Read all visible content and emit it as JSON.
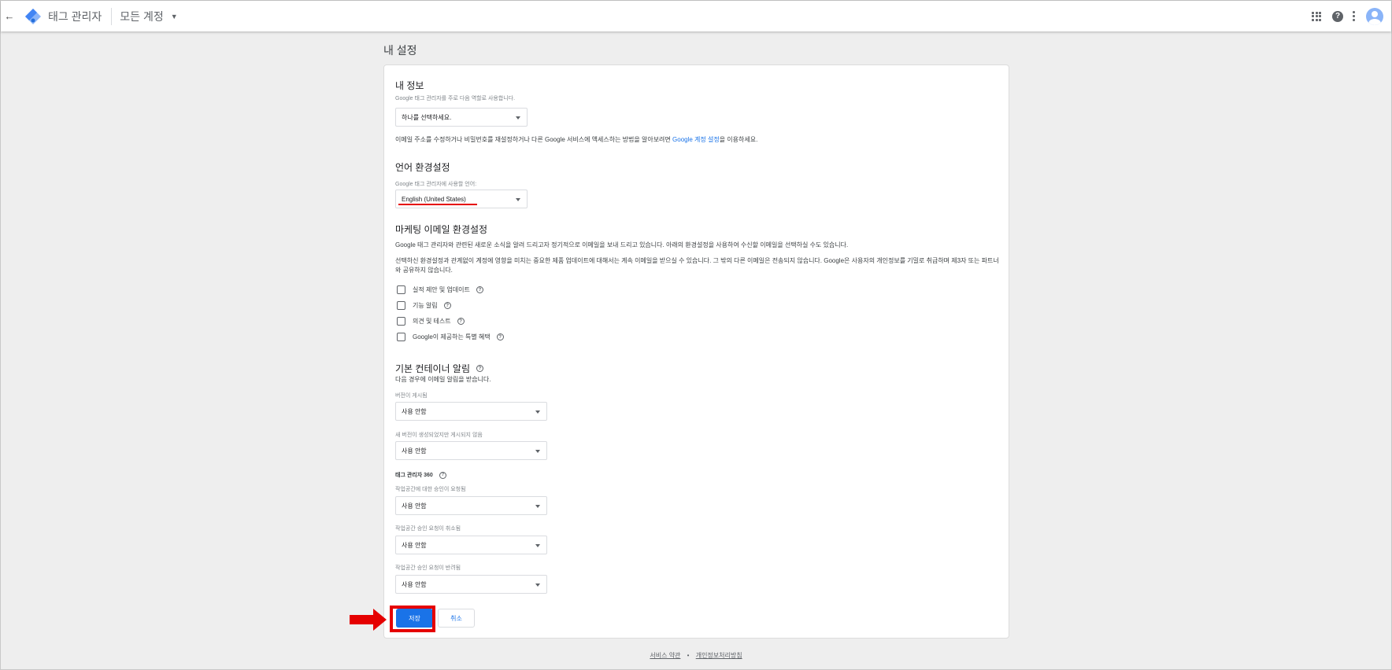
{
  "header": {
    "app_name": "태그 관리자",
    "account_label": "모든 계정"
  },
  "page_title": "내 설정",
  "my_info": {
    "heading": "내 정보",
    "role_label": "Google 태그 관리자를 주로 다음 역할로 사용합니다.",
    "role_value": "하나를 선택하세요.",
    "desc_before": "이메일 주소를 수정하거나 비밀번호를 재설정하거나 다른 Google 서비스에 액세스하는 방법을 알아보려면 ",
    "desc_link": "Google 계정 설정",
    "desc_after": "을 이용하세요."
  },
  "language": {
    "heading": "언어 환경설정",
    "label": "Google 태그 관리자에 사용할 언어:",
    "value": "English (United States)"
  },
  "marketing": {
    "heading": "마케팅 이메일 환경설정",
    "desc1": "Google 태그 관리자와 관련된 새로운 소식을 알려 드리고자 정기적으로 이메일을 보내 드리고 있습니다. 아래의 환경설정을 사용하여 수신할 이메일을 선택하실 수도 있습니다.",
    "desc2": "선택하신 환경설정과 관계없이 계정에 영향을 미치는 중요한 제품 업데이트에 대해서는 계속 이메일을 받으실 수 있습니다. 그 밖의 다른 이메일은 전송되지 않습니다. Google은 사용자의 개인정보를 기밀로 취급하며 제3자 또는 파트너와 공유하지 않습니다.",
    "options": [
      {
        "label": "실적 제안 및 업데이트",
        "checked": false
      },
      {
        "label": "기능 알림",
        "checked": false
      },
      {
        "label": "의견 및 테스트",
        "checked": false
      },
      {
        "label": "Google이 제공하는 특별 혜택",
        "checked": false
      }
    ]
  },
  "notifications": {
    "heading": "기본 컨테이너 알림",
    "desc": "다음 경우에 이메일 알림을 받습니다.",
    "published_label": "버전이 게시됨",
    "published_value": "사용 안함",
    "created_label": "새 버전이 생성되었지만 게시되지 않음",
    "created_value": "사용 안함",
    "tm360_heading": "태그 관리자 360",
    "approval_requested_label": "작업공간에 대한 승인이 요청됨",
    "approval_requested_value": "사용 안함",
    "approval_cancelled_label": "작업공간 승인 요청이 취소됨",
    "approval_cancelled_value": "사용 안함",
    "approval_rejected_label": "작업공간 승인 요청이 반려됨",
    "approval_rejected_value": "사용 안함"
  },
  "actions": {
    "save": "저장",
    "cancel": "취소"
  },
  "footer": {
    "terms": "서비스 약관",
    "separator": "•",
    "privacy": "개인정보처리방침"
  },
  "colors": {
    "accent": "#1a73e8",
    "highlight": "#e50000"
  }
}
